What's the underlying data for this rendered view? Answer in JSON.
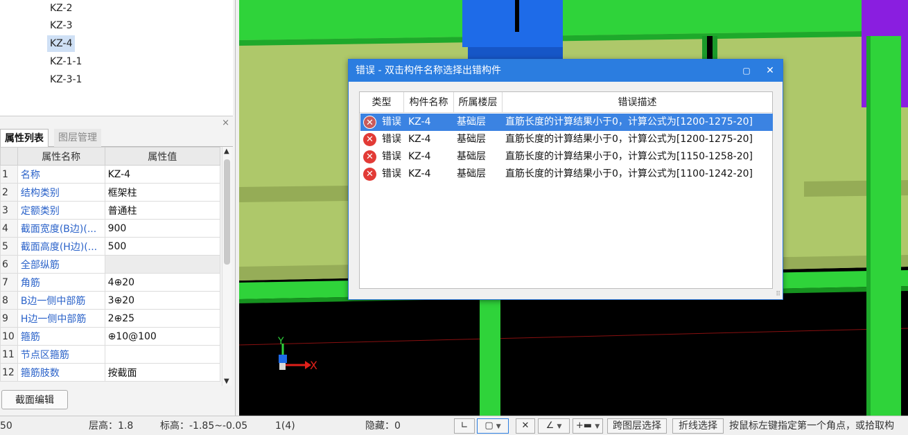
{
  "tree": {
    "items": [
      "KZ-2",
      "KZ-3",
      "KZ-4",
      "KZ-1-1",
      "KZ-3-1"
    ],
    "selected_index": 2
  },
  "properties": {
    "tabs": [
      "属性列表",
      "图层管理"
    ],
    "columns": [
      "属性名称",
      "属性值"
    ],
    "rows": [
      {
        "num": "1",
        "name": "名称",
        "value": "KZ-4"
      },
      {
        "num": "2",
        "name": "结构类别",
        "value": "框架柱"
      },
      {
        "num": "3",
        "name": "定额类别",
        "value": "普通柱"
      },
      {
        "num": "4",
        "name": "截面宽度(B边)(...",
        "value": "900"
      },
      {
        "num": "5",
        "name": "截面高度(H边)(...",
        "value": "500"
      },
      {
        "num": "6",
        "name": "全部纵筋",
        "value": ""
      },
      {
        "num": "7",
        "name": "角筋",
        "value": "4⊕20"
      },
      {
        "num": "8",
        "name": "B边一侧中部筋",
        "value": "3⊕20"
      },
      {
        "num": "9",
        "name": "H边一侧中部筋",
        "value": "2⊕25"
      },
      {
        "num": "10",
        "name": "箍筋",
        "value": "⊕10@100"
      },
      {
        "num": "11",
        "name": "节点区箍筋",
        "value": ""
      },
      {
        "num": "12",
        "name": "箍筋肢数",
        "value": "按截面"
      }
    ],
    "section_edit_label": "截面编辑",
    "close_glyph": "×"
  },
  "dialog": {
    "title": "错误 - 双击构件名称选择出错构件",
    "columns": [
      "类型",
      "构件名称",
      "所属楼层",
      "错误描述"
    ],
    "rows": [
      {
        "type": "错误",
        "name": "KZ-4",
        "floor": "基础层",
        "desc": "直筋长度的计算结果小于0，计算公式为[1200-1275-20]"
      },
      {
        "type": "错误",
        "name": "KZ-4",
        "floor": "基础层",
        "desc": "直筋长度的计算结果小于0，计算公式为[1200-1275-20]"
      },
      {
        "type": "错误",
        "name": "KZ-4",
        "floor": "基础层",
        "desc": "直筋长度的计算结果小于0，计算公式为[1150-1258-20]"
      },
      {
        "type": "错误",
        "name": "KZ-4",
        "floor": "基础层",
        "desc": "直筋长度的计算结果小于0，计算公式为[1100-1242-20]"
      }
    ],
    "selected_index": 0
  },
  "axes": {
    "y": "Y",
    "x": "X"
  },
  "status": {
    "left_fragment": "50",
    "floor_height": "层高：1.8",
    "elevation": "标高：-1.85~-0.05",
    "count": "1(4)",
    "hidden": "隐藏：0",
    "cross_layer_select": "跨图层选择",
    "polyline_select": "折线选择",
    "hint": "按鼠标左键指定第一个角点，或拾取构"
  },
  "colors": {
    "accent": "#2b7de0",
    "green_beam": "#2fd33a",
    "blue_column": "#1e6be8",
    "purple_column": "#8a1ee0",
    "slab": "#aec86a",
    "error_red": "#e23b36"
  }
}
